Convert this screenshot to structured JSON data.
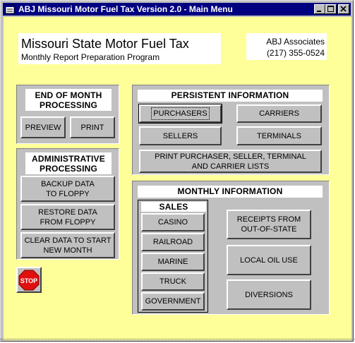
{
  "window": {
    "title": "ABJ Missouri Motor Fuel Tax Version 2.0 - Main Menu",
    "controls": [
      "minimize-icon",
      "maximize-icon",
      "close-icon"
    ]
  },
  "header": {
    "title": "Missouri State Motor Fuel Tax",
    "subtitle": "Monthly Report Preparation Program",
    "company": "ABJ Associates",
    "phone": "(217) 355-0524"
  },
  "end_of_month": {
    "heading_line1": "END OF MONTH",
    "heading_line2": "PROCESSING",
    "preview": "PREVIEW",
    "print": "PRINT"
  },
  "administrative": {
    "heading_line1": "ADMINISTRATIVE",
    "heading_line2": "PROCESSING",
    "backup_line1": "BACKUP DATA",
    "backup_line2": "TO FLOPPY",
    "restore_line1": "RESTORE DATA",
    "restore_line2": "FROM FLOPPY",
    "clear_line1": "CLEAR DATA TO START",
    "clear_line2": "NEW MONTH"
  },
  "persistent": {
    "heading": "PERSISTENT INFORMATION",
    "purchasers": "PURCHASERS",
    "carriers": "CARRIERS",
    "sellers": "SELLERS",
    "terminals": "TERMINALS",
    "print_lists_line1": "PRINT PURCHASER, SELLER, TERMINAL",
    "print_lists_line2": "AND CARRIER  LISTS"
  },
  "monthly": {
    "heading": "MONTHLY INFORMATION",
    "sales_heading": "SALES",
    "sales": [
      "CASINO",
      "RAILROAD",
      "MARINE",
      "TRUCK",
      "GOVERNMENT"
    ],
    "receipts_line1": "RECEIPTS FROM",
    "receipts_line2": "OUT-OF-STATE",
    "local_oil": "LOCAL OIL USE",
    "diversions": "DIVERSIONS"
  },
  "stop_button": {
    "label": "STOP",
    "color": "#e01010"
  },
  "colors": {
    "client_bg": "#ffff99",
    "titlebar": "#000080",
    "panel": "#c0c0c0"
  }
}
